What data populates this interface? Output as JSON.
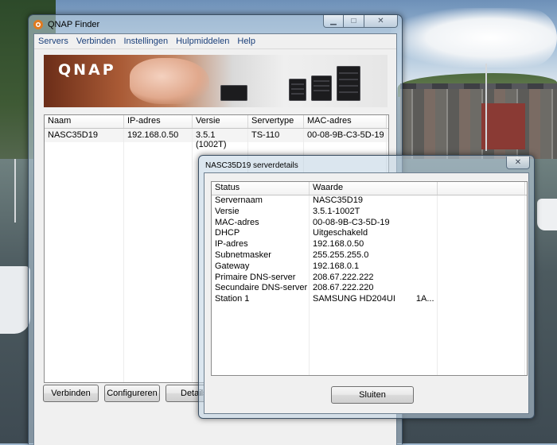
{
  "finder": {
    "title": "QNAP Finder",
    "menu": [
      "Servers",
      "Verbinden",
      "Instellingen",
      "Hulpmiddelen",
      "Help"
    ],
    "banner_logo": "QNAP",
    "columns": [
      "Naam",
      "IP-adres",
      "Versie",
      "Servertype",
      "MAC-adres"
    ],
    "rows": [
      [
        "NASC35D19",
        "192.168.0.50",
        "3.5.1 (1002T)",
        "TS-110",
        "00-08-9B-C3-5D-19"
      ]
    ],
    "buttons": {
      "connect": "Verbinden",
      "configure": "Configureren",
      "details": "Details"
    }
  },
  "details": {
    "title": "NASC35D19 serverdetails",
    "columns": [
      "Status",
      "Waarde"
    ],
    "rows": [
      [
        "Servernaam",
        "NASC35D19"
      ],
      [
        "Versie",
        "3.5.1-1002T"
      ],
      [
        "MAC-adres",
        "00-08-9B-C3-5D-19"
      ],
      [
        "DHCP",
        "Uitgeschakeld"
      ],
      [
        "IP-adres",
        "192.168.0.50"
      ],
      [
        "Subnetmasker",
        "255.255.255.0"
      ],
      [
        "Gateway",
        "192.168.0.1"
      ],
      [
        "Primaire DNS-server",
        "208.67.222.222"
      ],
      [
        "Secundaire DNS-server",
        "208.67.222.220"
      ],
      [
        "Station 1",
        "SAMSUNG HD204UI"
      ]
    ],
    "station_extra": "1A...",
    "close_button": "Sluiten"
  },
  "window_controls": {
    "minimize": "minimize-icon",
    "maximize": "maximize-icon",
    "close": "close-icon"
  },
  "colors": {
    "menu_text": "#1a3f7a",
    "banner_brown": "#6b2d18"
  }
}
